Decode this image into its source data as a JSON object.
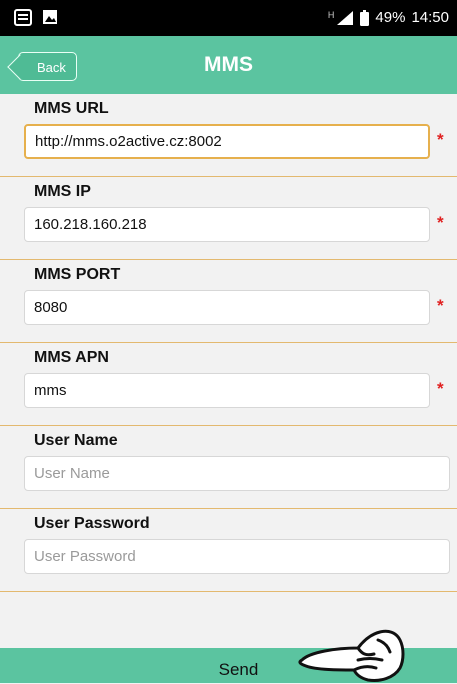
{
  "status_bar": {
    "battery": "49%",
    "time": "14:50",
    "network": "H",
    "icons_left": [
      "notification-document-icon",
      "notification-image-icon"
    ],
    "icons_right": [
      "signal-icon",
      "battery-icon"
    ]
  },
  "header": {
    "back_label": "Back",
    "title": "MMS"
  },
  "fields": [
    {
      "label": "MMS URL",
      "value": "http://mms.o2active.cz:8002",
      "placeholder": "",
      "required": true
    },
    {
      "label": "MMS IP",
      "value": "160.218.160.218",
      "placeholder": "",
      "required": true
    },
    {
      "label": "MMS PORT",
      "value": "8080",
      "placeholder": "",
      "required": true
    },
    {
      "label": "MMS APN",
      "value": "mms",
      "placeholder": "",
      "required": true
    },
    {
      "label": "User Name",
      "value": "",
      "placeholder": "User Name",
      "required": false
    },
    {
      "label": "User Password",
      "value": "",
      "placeholder": "User Password",
      "required": false
    }
  ],
  "required_marker": "*",
  "footer": {
    "send_label": "Send"
  },
  "colors": {
    "accent": "#5bc4a0",
    "divider": "#e3b96f",
    "focus_border": "#e6b04d",
    "required": "#e02020"
  },
  "icons": {
    "pointer": "pointing-hand-icon"
  }
}
